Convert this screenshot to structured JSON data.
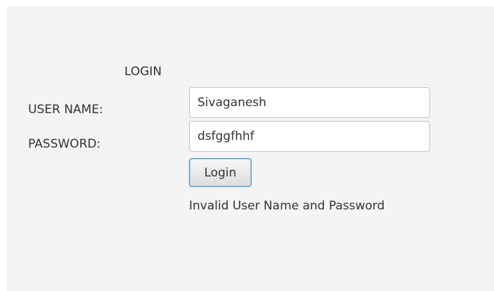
{
  "form": {
    "title": "LOGIN",
    "username_label": "USER NAME:",
    "username_value": "Sivaganesh",
    "password_label": "PASSWORD:",
    "password_value": "dsfggfhhf",
    "login_button": "Login",
    "status_message": "Invalid User Name and Password"
  }
}
